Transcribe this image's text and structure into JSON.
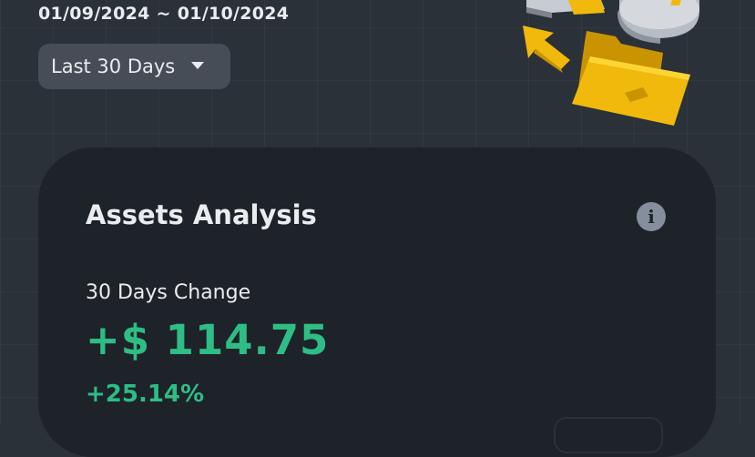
{
  "header": {
    "date_range": "01/09/2024 ~ 01/10/2024"
  },
  "period_selector": {
    "selected": "Last 30 Days",
    "icon": "caret-down-icon"
  },
  "assets_card": {
    "title": "Assets Analysis",
    "info_icon": "info-icon",
    "change_label": "30 Days Change",
    "change_amount": "+$ 114.75",
    "change_percent": "+25.14%"
  },
  "colors": {
    "background": "#2b3139",
    "card": "#1e2329",
    "positive": "#2ebd85",
    "brand_yellow": "#f0b90b",
    "text_primary": "#eaecef"
  }
}
